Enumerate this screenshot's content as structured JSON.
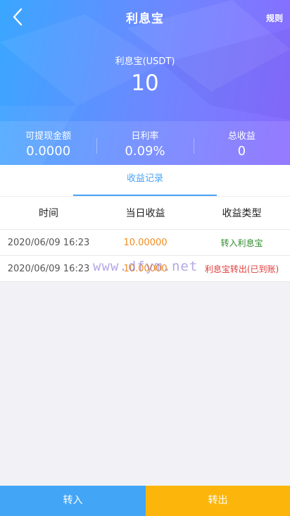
{
  "nav": {
    "title": "利息宝",
    "rules_label": "规则",
    "back_icon": "chevron-left-icon"
  },
  "asset": {
    "name": "利息宝(USDT)",
    "value": "10"
  },
  "stats": [
    {
      "label": "可提现金额",
      "value": "0.0000"
    },
    {
      "label": "日利率",
      "value": "0.09%"
    },
    {
      "label": "总收益",
      "value": "0"
    }
  ],
  "tab": {
    "label": "收益记录",
    "active": true
  },
  "table": {
    "headers": [
      "时间",
      "当日收益",
      "收益类型"
    ],
    "rows": [
      {
        "time": "2020/06/09 16:23",
        "amount": "10.00000",
        "type": "转入利息宝",
        "type_color": "#2e8b2e"
      },
      {
        "time": "2020/06/09 16:23",
        "amount": "10.00000",
        "type": "利息宝转出(已到账)",
        "type_color": "#e03c3c"
      }
    ]
  },
  "watermark": "www.dfym.net",
  "actions": {
    "transfer_in": "转入",
    "transfer_out": "转出"
  },
  "colors": {
    "accent": "#4aa3f5",
    "amount": "#f08c1e",
    "in_button": "#43a5f6",
    "out_button": "#fcb60b"
  }
}
